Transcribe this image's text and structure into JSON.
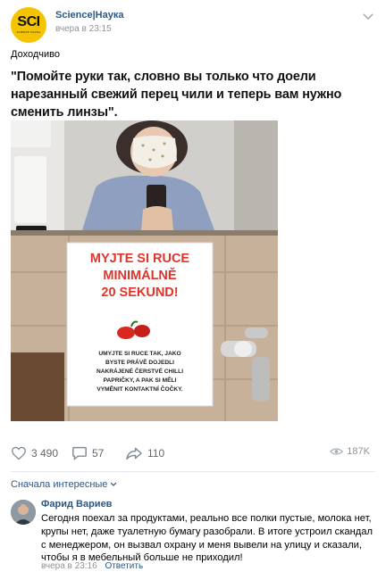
{
  "post": {
    "author": "Science|Наука",
    "time": "вчера в 23:15",
    "avatar_logo": "SCI",
    "avatar_logo_sub": "SCIENCE НАУКА",
    "tag": "Доходчиво",
    "quote": "\"Помойте руки так, словно вы только что доели нарезанный свежий перец чили и теперь вам нужно сменить линзы\"."
  },
  "sign": {
    "title_line1": "MYJTE SI RUCE",
    "title_line2": "MINIMÁLNĚ",
    "title_line3": "20 SEKUND!",
    "body_line1": "UMYJTE SI RUCE TAK, JAKO",
    "body_line2": "BYSTE PRÁVĚ DOJEDLI",
    "body_line3": "NAKRÁJENÉ ČERSTVÉ CHILLI",
    "body_line4": "PAPRIČKY, A PAK SI MĚLI",
    "body_line5": "VYMĚNIT KONTAKTNÍ ČOČKY."
  },
  "actions": {
    "likes": "3 490",
    "comments": "57",
    "shares": "110",
    "views": "187K"
  },
  "comments_sort": "Сначала интересные",
  "comment": {
    "author": "Фарид Вариев",
    "text": "Сегодня поехал за продуктами, реально все полки пустые, молока нет, крупы нет, даже туалетную бумагу разобрали. В итоге устроил скандал с менеджером, он вызвал охрану и меня вывели на улицу и сказали, чтобы я в мебельный больше не приходил!",
    "time": "вчера в 23:16",
    "reply": "Ответить"
  },
  "colors": {
    "link": "#2a5885",
    "muted": "#939393",
    "brand_yellow": "#f5c400",
    "sign_red": "#e0342a"
  }
}
